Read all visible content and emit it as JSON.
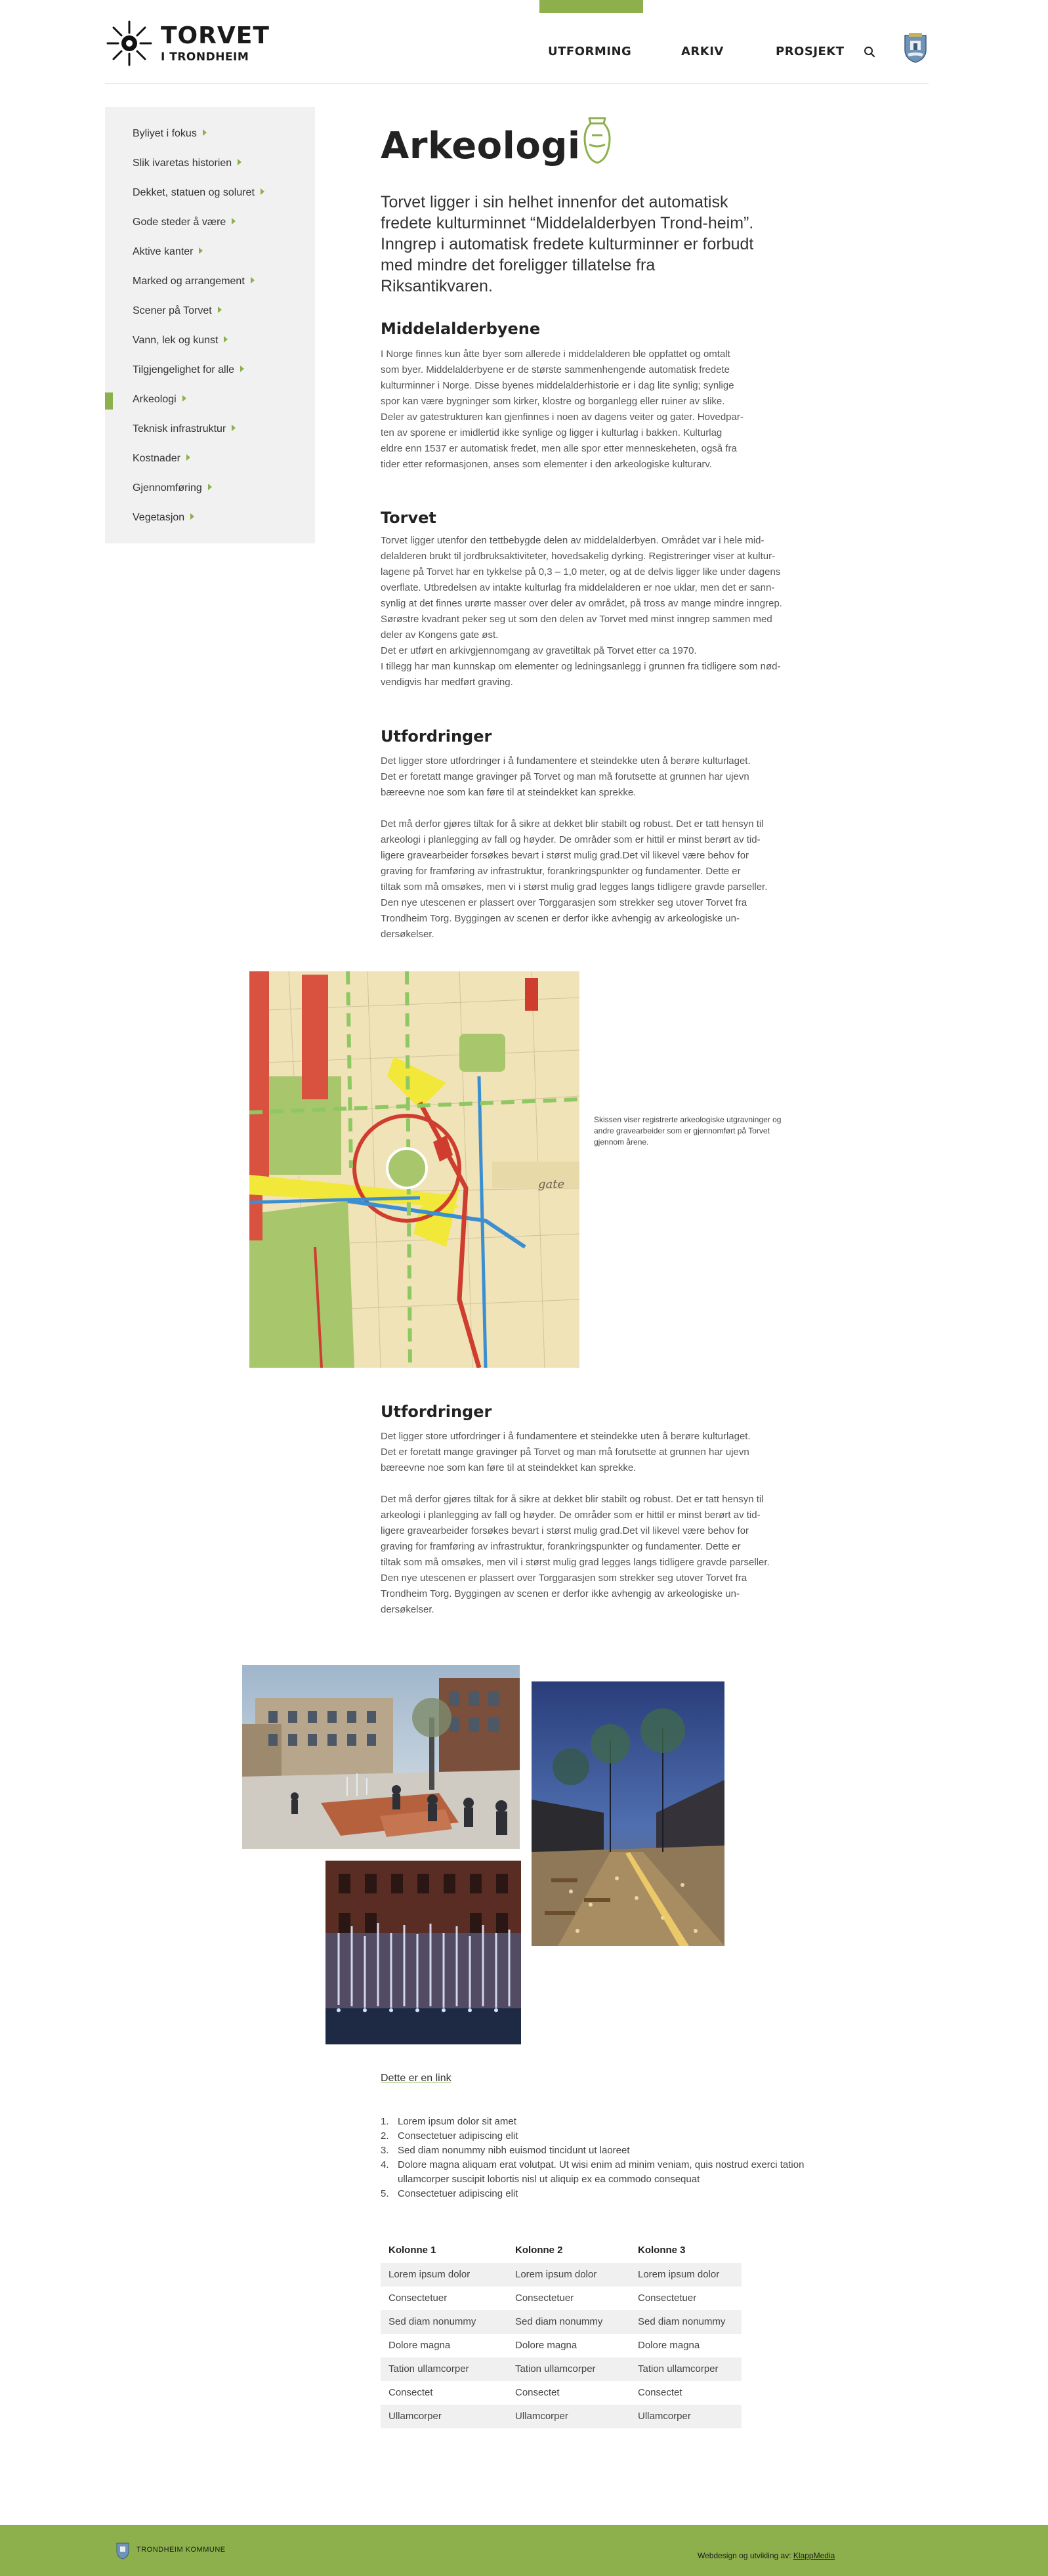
{
  "brand": {
    "name_line1": "TORVET",
    "name_line2": "I TRONDHEIM"
  },
  "nav": {
    "items": [
      "UTFORMING",
      "ARKIV",
      "PROSJEKT"
    ],
    "active": "ARKIV"
  },
  "colors": {
    "accent": "#8db04c",
    "sidebar_bg": "#f1f1f1",
    "text": "#333333"
  },
  "sidebar": {
    "items": [
      "Byliyet i fokus",
      "Slik ivaretas historien",
      "Dekket, statuen og soluret",
      "Gode steder å være",
      "Aktive kanter",
      "Marked og arrangement",
      "Scener på Torvet",
      "Vann, lek og kunst",
      "Tilgjengelighet for alle",
      "Arkeologi",
      "Teknisk infrastruktur",
      "Kostnader",
      "Gjennomføring",
      "Vegetasjon"
    ],
    "active_index": 9
  },
  "main": {
    "title": "Arkeologi",
    "lead": "Torvet ligger i sin helhet innenfor det automatisk fredete kulturminnet “Middelalderbyen Trond-heim”. Inngrep i automatisk fredete kulturminner er forbudt med mindre det foreligger tillatelse fra Riksantikvaren.",
    "sections": [
      {
        "heading": "Middelalderbyene",
        "text": "I Norge finnes kun åtte byer som allerede i middelalderen ble oppfattet og omtalt\nsom byer. Middelalderbyene er de største sammenhengende automatisk fredete\nkulturminner i Norge. Disse byenes middelalderhistorie er i dag lite synlig; synlige\nspor kan være bygninger som kirker, klostre og borganlegg eller ruiner av slike.\nDeler av gatestrukturen kan gjenfinnes i noen av dagens veiter og gater. Hovedpar-\nten av sporene er imidlertid ikke synlige og ligger i kulturlag i bakken. Kulturlag\neldre enn 1537 er automatisk fredet, men alle spor etter menneskeheten, også fra\ntider etter reformasjonen, anses som elementer i den arkeologiske kulturarv."
      },
      {
        "heading": "Torvet",
        "text": "Torvet ligger utenfor den tettbebygde delen av middelalderbyen. Området var i hele mid-\ndelalderen brukt til jordbruksaktiviteter, hovedsakelig dyrking. Registreringer viser at kultur-\nlagene på Torvet har en tykkelse på 0,3 – 1,0 meter, og at de delvis ligger like under dagens\noverflate. Utbredelsen av intakte kulturlag fra middelalderen er noe uklar, men det er sann-\nsynlig at det finnes urørte masser over deler av området, på tross av mange mindre inngrep.\nSørøstre kvadrant peker seg ut som den delen av Torvet med minst inngrep sammen med\ndeler av Kongens gate øst.\nDet er utført en arkivgjennomgang av gravetiltak på Torvet etter ca 1970.\nI tillegg har man kunnskap om elementer og ledningsanlegg i grunnen fra tidligere som nød-\nvendigvis har medført graving."
      },
      {
        "heading": "Utfordringer",
        "text": "Det ligger store utfordringer i å fundamentere et steindekke uten å berøre kulturlaget.\nDet er foretatt mange gravinger på Torvet og man må forutsette at grunnen har ujevn\nbæreevne noe som kan føre til at steindekket kan sprekke.\n\nDet må derfor gjøres tiltak for å sikre at dekket blir stabilt og robust. Det er tatt hensyn til\narkeologi i planlegging av fall og høyder. De områder som er hittil er minst berørt av tid-\nligere gravearbeider forsøkes bevart i størst mulig grad.Det vil likevel være behov for\ngraving for framføring av infrastruktur, forankringspunkter og fundamenter. Dette er\ntiltak som må omsøkes, men vi i størst mulig grad legges langs tidligere gravde parseller.\nDen nye utescenen er plassert over Torggarasjen som strekker seg utover Torvet fra\nTrondheim Torg. Byggingen av scenen er derfor ikke avhengig av arkeologiske un-\ndersøkelser."
      },
      {
        "heading": "Utfordringer",
        "text": "Det ligger store utfordringer i å fundamentere et steindekke uten å berøre kulturlaget.\nDet er foretatt mange gravinger på Torvet og man må forutsette at grunnen har ujevn\nbæreevne noe som kan føre til at steindekket kan sprekke.\n\nDet må derfor gjøres tiltak for å sikre at dekket blir stabilt og robust. Det er tatt hensyn til\narkeologi i planlegging av fall og høyder. De områder som er hittil er minst berørt av tid-\nligere gravearbeider forsøkes bevart i størst mulig grad.Det vil likevel være behov for\ngraving for framføring av infrastruktur, forankringspunkter og fundamenter. Dette er\ntiltak som må omsøkes, men vil i størst mulig grad legges langs tidligere gravde parseller.\nDen nye utescenen er plassert over Torggarasjen som strekker seg utover Torvet fra\nTrondheim Torg. Byggingen av scenen er derfor ikke avhengig av arkeologiske un-\ndersøkelser."
      }
    ],
    "map_caption": "Skissen viser registrerte arkeologiske utgravninger og andre gravearbeider som er gjennomført på Torvet gjennom årene.",
    "map_label": "gate",
    "link_text": "Dette er en link",
    "ordered_list": [
      "Lorem ipsum dolor sit amet",
      "Consectetuer adipiscing elit",
      "Sed diam nonummy nibh euismod tincidunt ut laoreet",
      "Dolore magna aliquam erat volutpat. Ut wisi enim ad minim veniam, quis nostrud exerci tation ullamcorper suscipit lobortis nisl ut aliquip ex ea commodo consequat",
      "Consectetuer adipiscing elit"
    ],
    "table": {
      "headers": [
        "Kolonne 1",
        "Kolonne 2",
        "Kolonne 3"
      ],
      "rows": [
        [
          "Lorem ipsum dolor",
          "Lorem ipsum dolor",
          "Lorem ipsum dolor"
        ],
        [
          "Consectetuer",
          "Consectetuer",
          "Consectetuer"
        ],
        [
          "Sed diam nonummy",
          "Sed diam nonummy",
          "Sed diam nonummy"
        ],
        [
          "Dolore magna",
          "Dolore magna",
          "Dolore magna"
        ],
        [
          "Tation ullamcorper",
          "Tation ullamcorper",
          "Tation ullamcorper"
        ],
        [
          "Consectet",
          "Consectet",
          "Consectet"
        ],
        [
          "Ullamcorper",
          "Ullamcorper",
          "Ullamcorper"
        ]
      ]
    }
  },
  "footer": {
    "left": "TRONDHEIM KOMMUNE",
    "right_prefix": "Webdesign og utvikling av: ",
    "right_link": "KlappMedia"
  }
}
